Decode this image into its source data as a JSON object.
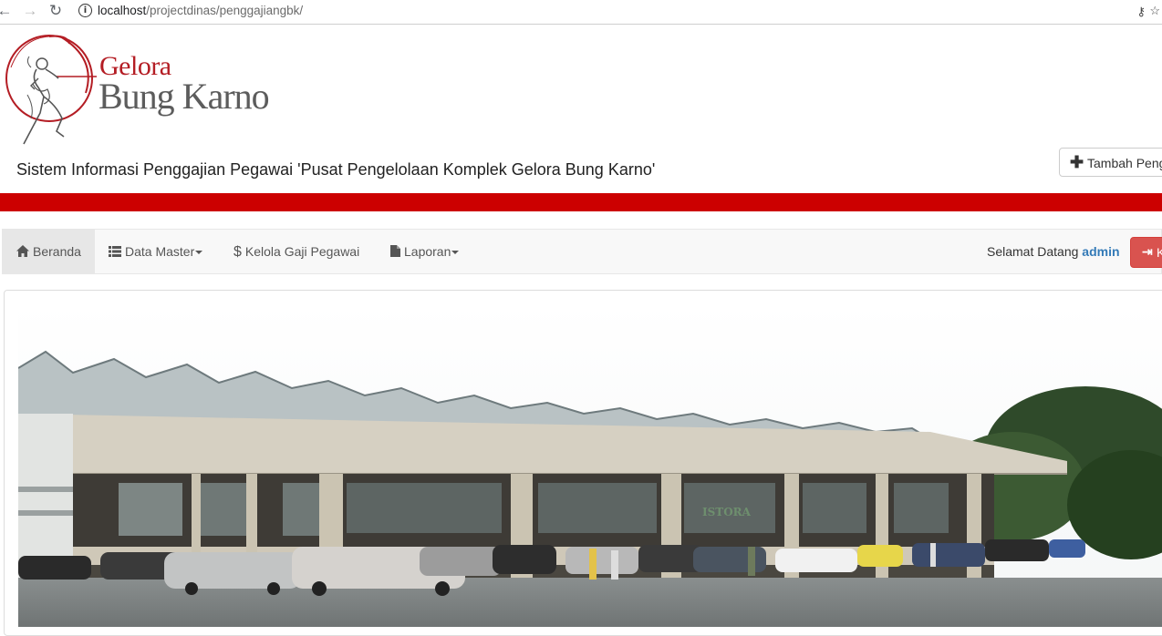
{
  "browser": {
    "url_host": "localhost",
    "url_path": "/projectdinas/penggajiangbk/"
  },
  "header": {
    "logo_line1": "Gelora",
    "logo_line2": "Bung Karno",
    "site_title": "Sistem Informasi Penggajian Pegawai 'Pusat Pengelolaan Komplek Gelora Bung Karno'",
    "add_button_label": "Tambah Peng"
  },
  "navbar": {
    "items": [
      {
        "label": "Beranda",
        "icon": "home-icon"
      },
      {
        "label": "Data Master",
        "icon": "list-icon"
      },
      {
        "label": "Kelola Gaji Pegawai",
        "icon": "dollar-icon"
      },
      {
        "label": "Laporan",
        "icon": "file-icon"
      }
    ],
    "welcome_text": "Selamat Datang",
    "username": "admin",
    "logout_label": "K"
  },
  "colors": {
    "brand_red": "#cc0000",
    "logo_red": "#b41d24",
    "link_blue": "#337ab7",
    "danger": "#d9534f"
  }
}
